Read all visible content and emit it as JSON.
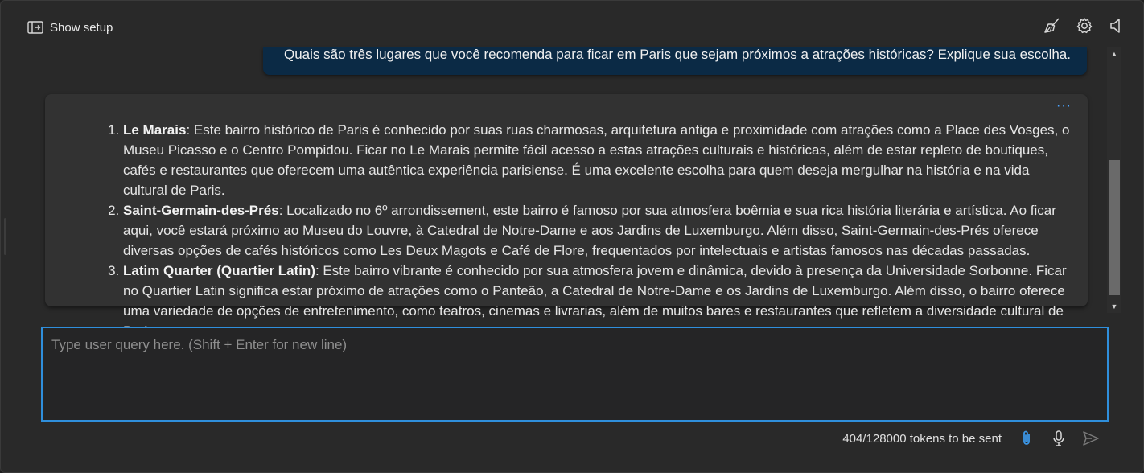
{
  "header": {
    "show_setup_label": "Show setup",
    "icons": [
      "broom-icon",
      "gear-icon",
      "speaker-icon"
    ]
  },
  "chat": {
    "user_message": "Quais são três lugares que você recomenda para ficar em Paris que sejam próximos a atrações históricas? Explique sua escolha.",
    "assistant_items": [
      {
        "title": "Le Marais",
        "text": ": Este bairro histórico de Paris é conhecido por suas ruas charmosas, arquitetura antiga e proximidade com atrações como a Place des Vosges, o Museu Picasso e o Centro Pompidou. Ficar no Le Marais permite fácil acesso a estas atrações culturais e históricas, além de estar repleto de boutiques, cafés e restaurantes que oferecem uma autêntica experiência parisiense. É uma excelente escolha para quem deseja mergulhar na história e na vida cultural de Paris."
      },
      {
        "title": "Saint-Germain-des-Prés",
        "text": ": Localizado no 6º arrondissement, este bairro é famoso por sua atmosfera boêmia e sua rica história literária e artística. Ao ficar aqui, você estará próximo ao Museu do Louvre, à Catedral de Notre-Dame e aos Jardins de Luxemburgo. Além disso, Saint-Germain-des-Prés oferece diversas opções de cafés históricos como Les Deux Magots e Café de Flore, frequentados por intelectuais e artistas famosos nas décadas passadas."
      },
      {
        "title": "Latim Quarter (Quartier Latin)",
        "text": ": Este bairro vibrante é conhecido por sua atmosfera jovem e dinâmica, devido à presença da Universidade Sorbonne. Ficar no Quartier Latin significa estar próximo de atrações como o Panteão, a Catedral de Notre-Dame e os Jardins de Luxemburgo. Além disso, o bairro oferece uma variedade de opções de entretenimento, como teatros, cinemas e livrarias, além de muitos bares e restaurantes que refletem a diversidade cultural de Paris."
      }
    ],
    "more_label": "···"
  },
  "input": {
    "placeholder": "Type user query here. (Shift + Enter for new line)",
    "value": ""
  },
  "footer": {
    "token_count": "404/128000 tokens to be sent",
    "icons": [
      "paperclip-icon",
      "microphone-icon",
      "send-icon"
    ]
  },
  "colors": {
    "accent": "#2f8fdc",
    "user_bubble": "#0b2a45",
    "assistant_bubble": "#323232",
    "background": "#292929"
  }
}
